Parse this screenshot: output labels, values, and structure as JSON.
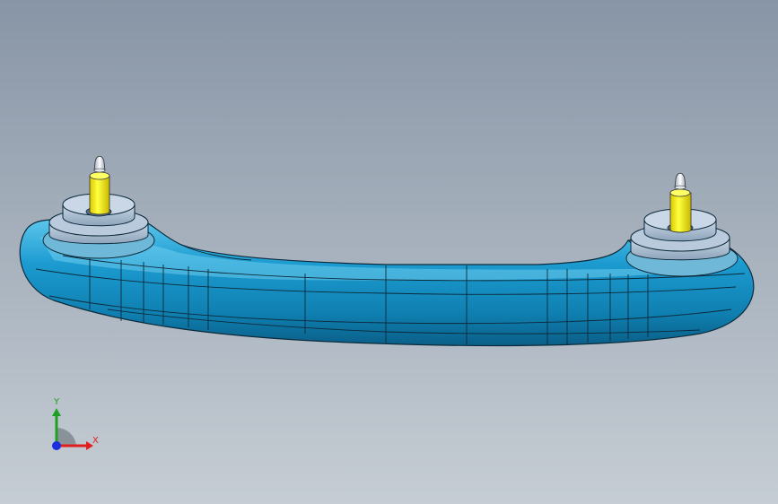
{
  "viewport": {
    "background_top": "#8895a6",
    "background_bottom": "#c6cdd4"
  },
  "model": {
    "body_color": "#1190c4",
    "edge_color": "#0c2a3a",
    "pin_color": "#ffee00",
    "boss_color": "#a8bfd6"
  },
  "triad": {
    "x_label": "X",
    "y_label": "Y",
    "x_color": "#e02020",
    "y_color": "#20a020",
    "z_color": "#1a2ee0"
  }
}
